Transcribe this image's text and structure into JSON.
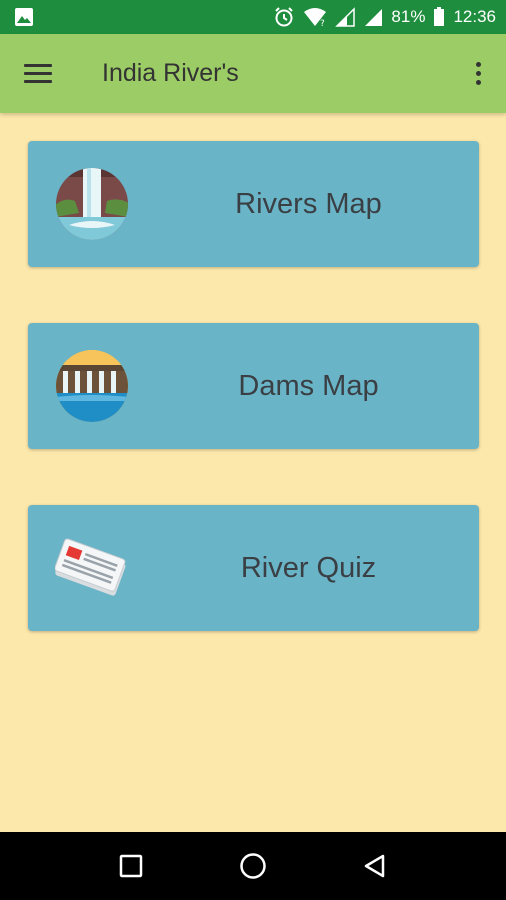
{
  "status_bar": {
    "battery_percent": "81%",
    "time": "12:36",
    "icons": [
      "image-icon",
      "alarm-icon",
      "wifi-icon",
      "signal-icon",
      "signal-icon",
      "battery-icon"
    ]
  },
  "app_bar": {
    "title": "India River's",
    "menu_icon": "hamburger-menu-icon",
    "overflow_icon": "more-vert-icon"
  },
  "menu": {
    "items": [
      {
        "label": "Rivers Map",
        "icon": "waterfall-icon"
      },
      {
        "label": "Dams Map",
        "icon": "dam-icon"
      },
      {
        "label": "River Quiz",
        "icon": "newspaper-icon"
      }
    ]
  },
  "nav_bar": {
    "buttons": [
      "recents-square-icon",
      "home-circle-icon",
      "back-triangle-icon"
    ]
  },
  "colors": {
    "status_bar": "#1e8e3e",
    "app_bar": "#9ccc65",
    "background": "#fde8ab",
    "card": "#6ab4c8",
    "card_text": "#3a3f44"
  }
}
